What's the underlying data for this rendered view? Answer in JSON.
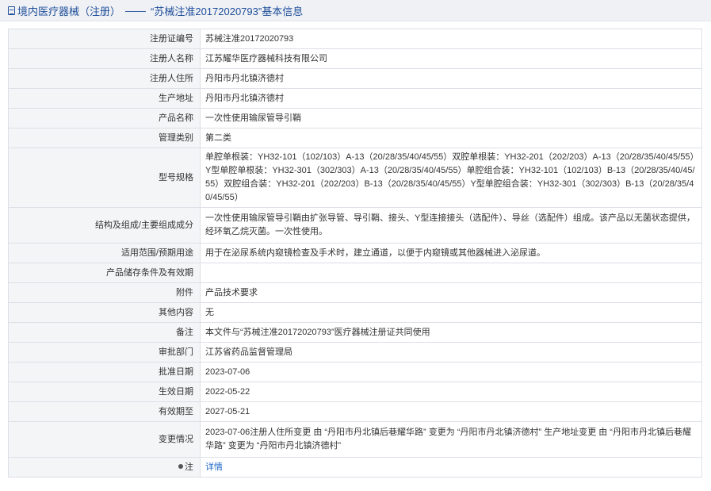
{
  "breadcrumb": {
    "section": "境内医疗器械（注册）",
    "separator": "——",
    "title": "“苏械注准20172020793”基本信息"
  },
  "rows": [
    {
      "label": "注册证编号",
      "value": "苏械注准20172020793"
    },
    {
      "label": "注册人名称",
      "value": "江苏耀华医疗器械科技有限公司"
    },
    {
      "label": "注册人住所",
      "value": "丹阳市丹北镇济德村"
    },
    {
      "label": "生产地址",
      "value": "丹阳市丹北镇济德村"
    },
    {
      "label": "产品名称",
      "value": "一次性使用输尿管导引鞘"
    },
    {
      "label": "管理类别",
      "value": "第二类"
    },
    {
      "label": "型号规格",
      "value": "单腔单根装：YH32-101（102/103）A-13（20/28/35/40/45/55）双腔单根装：YH32-201（202/203）A-13（20/28/35/40/45/55）Y型单腔单根装：YH32-301（302/303）A-13（20/28/35/40/45/55）单腔组合装：YH32-101（102/103）B-13（20/28/35/40/45/55）双腔组合装：YH32-201（202/203）B-13（20/28/35/40/45/55）Y型单腔组合装：YH32-301（302/303）B-13（20/28/35/40/45/55）"
    },
    {
      "label": "结构及组成/主要组成成分",
      "value": "一次性使用输尿管导引鞘由扩张导管、导引鞘、接头、Y型连接接头（选配件）、导丝（选配件）组成。该产品以无菌状态提供，经环氧乙烷灭菌。一次性使用。"
    },
    {
      "label": "适用范围/预期用途",
      "value": "用于在泌尿系统内窥镜检查及手术时，建立通道，以便于内窥镜或其他器械进入泌尿道。"
    },
    {
      "label": "产品储存条件及有效期",
      "value": ""
    },
    {
      "label": "附件",
      "value": "产品技术要求"
    },
    {
      "label": "其他内容",
      "value": "无"
    },
    {
      "label": "备注",
      "value": "本文件与“苏械注准20172020793”医疗器械注册证共同使用"
    },
    {
      "label": "审批部门",
      "value": "江苏省药品监督管理局"
    },
    {
      "label": "批准日期",
      "value": "2023-07-06"
    },
    {
      "label": "生效日期",
      "value": "2022-05-22"
    },
    {
      "label": "有效期至",
      "value": "2027-05-21"
    },
    {
      "label": "变更情况",
      "value": "2023-07-06注册人住所变更 由 “丹阳市丹北镇后巷耀华路” 变更为 “丹阳市丹北镇济德村” 生产地址变更 由 “丹阳市丹北镇后巷耀华路” 变更为 “丹阳市丹北镇济德村”"
    },
    {
      "label": "注",
      "value": "详情"
    }
  ]
}
